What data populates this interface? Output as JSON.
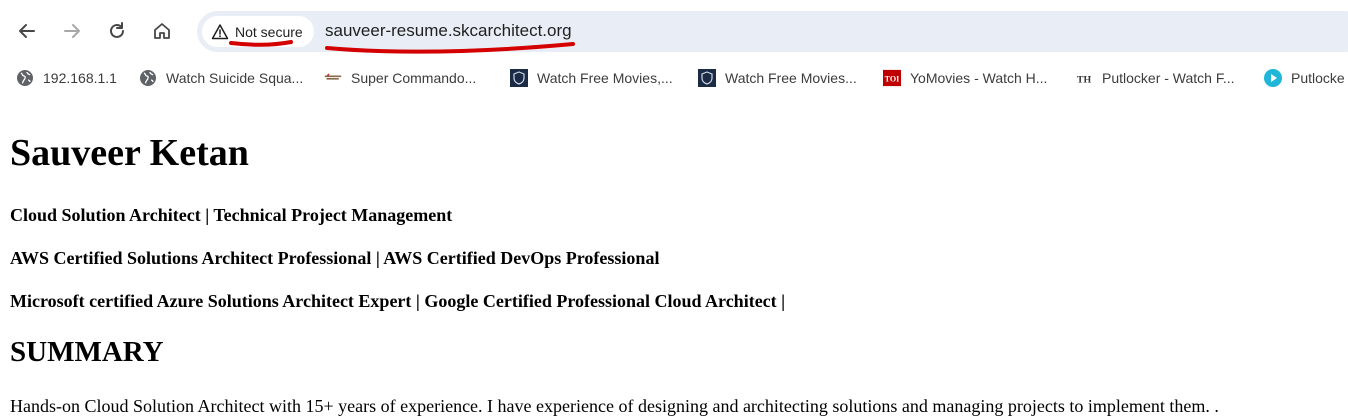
{
  "browser": {
    "security_label": "Not secure",
    "url": "sauveer-resume.skcarchitect.org",
    "nav_icons": [
      "back-icon",
      "forward-icon",
      "reload-icon",
      "home-icon"
    ],
    "annotation_color": "#d40000"
  },
  "bookmarks": [
    {
      "label": "192.168.1.1",
      "icon": "globe-icon"
    },
    {
      "label": "Watch Suicide Squa...",
      "icon": "globe-icon"
    },
    {
      "label": "Super Commando...",
      "icon": "site-icon"
    },
    {
      "label": "Watch Free Movies,...",
      "icon": "shield-icon"
    },
    {
      "label": "Watch Free Movies...",
      "icon": "shield-icon"
    },
    {
      "label": "YoMovies - Watch H...",
      "icon": "toi-icon"
    },
    {
      "label": "Putlocker - Watch F...",
      "icon": "th-icon"
    },
    {
      "label": "Putlocke",
      "icon": "play-icon"
    }
  ],
  "resume": {
    "name": "Sauveer Ketan",
    "roles": [
      "Cloud Solution Architect | Technical Project Management",
      "AWS Certified Solutions Architect Professional | AWS Certified DevOps Professional",
      "Microsoft certified Azure Solutions Architect Expert | Google Certified Professional Cloud Architect |"
    ],
    "summary_heading": "SUMMARY",
    "summary_text": "Hands-on Cloud Solution Architect with 15+ years of experience. I have experience of designing and architecting solutions and managing projects to implement them. ."
  }
}
